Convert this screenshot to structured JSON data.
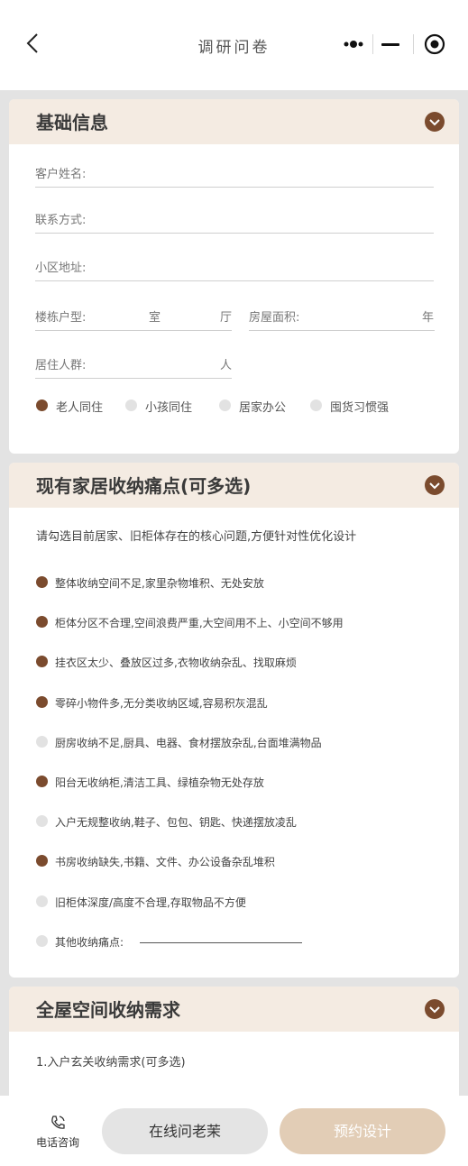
{
  "nav": {
    "title": "调研问卷"
  },
  "basic": {
    "title": "基础信息",
    "name_label": "客户姓名:",
    "contact_label": "联系方式:",
    "address_label": "小区地址:",
    "layout_label": "楼栋户型:",
    "room_unit": "室",
    "hall_unit": "厅",
    "area_label": "房屋面积:",
    "year_unit": "年",
    "residents_label": "居住人群:",
    "people_unit": "人",
    "options": [
      {
        "label": "老人同住",
        "selected": true
      },
      {
        "label": "小孩同住",
        "selected": false
      },
      {
        "label": "居家办公",
        "selected": false
      },
      {
        "label": "囤货习惯强",
        "selected": false
      }
    ]
  },
  "pain": {
    "title": "现有家居收纳痛点(可多选)",
    "intro": "请勾选目前居家、旧柜体存在的核心问题,方便针对性优化设计",
    "items": [
      {
        "label": "整体收纳空间不足,家里杂物堆积、无处安放",
        "selected": true
      },
      {
        "label": "柜体分区不合理,空间浪费严重,大空间用不上、小空间不够用",
        "selected": true
      },
      {
        "label": "挂衣区太少、叠放区过多,衣物收纳杂乱、找取麻烦",
        "selected": true
      },
      {
        "label": "零碎小物件多,无分类收纳区域,容易积灰混乱",
        "selected": true
      },
      {
        "label": "厨房收纳不足,厨具、电器、食材摆放杂乱,台面堆满物品",
        "selected": false
      },
      {
        "label": "阳台无收纳柜,清洁工具、绿植杂物无处存放",
        "selected": true
      },
      {
        "label": "入户无规整收纳,鞋子、包包、钥匙、快递摆放凌乱",
        "selected": false
      },
      {
        "label": "书房收纳缺失,书籍、文件、办公设备杂乱堆积",
        "selected": true
      },
      {
        "label": "旧柜体深度/高度不合理,存取物品不方便",
        "selected": false
      },
      {
        "label": "其他收纳痛点:",
        "selected": false
      }
    ]
  },
  "whole": {
    "title": "全屋空间收纳需求",
    "question1": "1.入户玄关收纳需求(可多选)"
  },
  "bottom": {
    "phone_label": "电话咨询",
    "ask_label": "在线问老茉",
    "book_label": "预约设计"
  },
  "colors": {
    "accent": "#7b4b2e",
    "header_bg": "#f4ebe2",
    "book_btn": "#e2cdb6"
  }
}
